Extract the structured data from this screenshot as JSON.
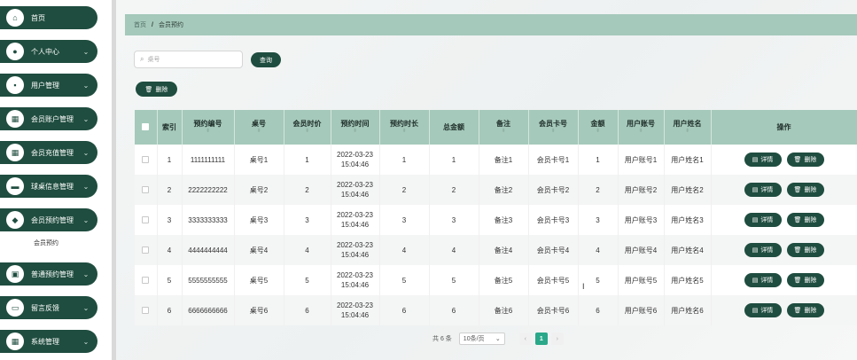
{
  "sidebar": {
    "items": [
      {
        "label": "首页",
        "icon": "home-icon",
        "glyph": "⌂",
        "has_chevron": false
      },
      {
        "label": "个人中心",
        "icon": "person-icon",
        "glyph": "●",
        "has_chevron": true
      },
      {
        "label": "用户管理",
        "icon": "users-icon",
        "glyph": "▪",
        "has_chevron": true
      },
      {
        "label": "会员账户管理",
        "icon": "grid-icon",
        "glyph": "▦",
        "has_chevron": true
      },
      {
        "label": "会员充值管理",
        "icon": "grid-icon",
        "glyph": "▦",
        "has_chevron": true
      },
      {
        "label": "球桌信息管理",
        "icon": "table-icon",
        "glyph": "▬",
        "has_chevron": true
      },
      {
        "label": "会员预约管理",
        "icon": "shield-icon",
        "glyph": "◆",
        "has_chevron": true
      },
      {
        "label": "普通预约管理",
        "icon": "calendar-icon",
        "glyph": "▣",
        "has_chevron": true
      },
      {
        "label": "留言反馈",
        "icon": "monitor-icon",
        "glyph": "▭",
        "has_chevron": true
      },
      {
        "label": "系统管理",
        "icon": "grid-icon",
        "glyph": "▦",
        "has_chevron": true
      }
    ],
    "submenu_active": "会员预约"
  },
  "breadcrumb": {
    "home": "首页",
    "separator": "/",
    "current": "会员预约"
  },
  "search": {
    "placeholder": "桌号",
    "button_label": "查询"
  },
  "toolbar": {
    "delete_label": "删除"
  },
  "table": {
    "columns": [
      "索引",
      "预约编号",
      "桌号",
      "会员时价",
      "预约时间",
      "预约时长",
      "总金额",
      "备注",
      "会员卡号",
      "金额",
      "用户账号",
      "用户姓名",
      "操作"
    ],
    "sortable": [
      false,
      true,
      true,
      true,
      true,
      true,
      false,
      true,
      true,
      true,
      true,
      true,
      false
    ],
    "rows": [
      {
        "index": "1",
        "booking_no": "1111111111",
        "table_no": "桌号1",
        "price": "1",
        "time": "2022-03-23 15:04:46",
        "duration": "1",
        "total": "1",
        "note": "备注1",
        "card_no": "会员卡号1",
        "amount": "1",
        "account": "用户账号1",
        "name": "用户姓名1"
      },
      {
        "index": "2",
        "booking_no": "2222222222",
        "table_no": "桌号2",
        "price": "2",
        "time": "2022-03-23 15:04:46",
        "duration": "2",
        "total": "2",
        "note": "备注2",
        "card_no": "会员卡号2",
        "amount": "2",
        "account": "用户账号2",
        "name": "用户姓名2"
      },
      {
        "index": "3",
        "booking_no": "3333333333",
        "table_no": "桌号3",
        "price": "3",
        "time": "2022-03-23 15:04:46",
        "duration": "3",
        "total": "3",
        "note": "备注3",
        "card_no": "会员卡号3",
        "amount": "3",
        "account": "用户账号3",
        "name": "用户姓名3"
      },
      {
        "index": "4",
        "booking_no": "4444444444",
        "table_no": "桌号4",
        "price": "4",
        "time": "2022-03-23 15:04:46",
        "duration": "4",
        "total": "4",
        "note": "备注4",
        "card_no": "会员卡号4",
        "amount": "4",
        "account": "用户账号4",
        "name": "用户姓名4"
      },
      {
        "index": "5",
        "booking_no": "5555555555",
        "table_no": "桌号5",
        "price": "5",
        "time": "2022-03-23 15:04:46",
        "duration": "5",
        "total": "5",
        "note": "备注5",
        "card_no": "会员卡号5",
        "amount": "5",
        "account": "用户账号5",
        "name": "用户姓名5"
      },
      {
        "index": "6",
        "booking_no": "6666666666",
        "table_no": "桌号6",
        "price": "6",
        "time": "2022-03-23 15:04:46",
        "duration": "6",
        "total": "6",
        "note": "备注6",
        "card_no": "会员卡号6",
        "amount": "6",
        "account": "用户账号6",
        "name": "用户姓名6"
      }
    ],
    "actions": {
      "detail": "详情",
      "delete": "删除"
    }
  },
  "pagination": {
    "total": "共 6 条",
    "page_size": "10条/页",
    "current_page": "1"
  },
  "colors": {
    "primary": "#1f4d3f",
    "header_bg": "#a5c9bb",
    "active_page": "#2aa889"
  }
}
